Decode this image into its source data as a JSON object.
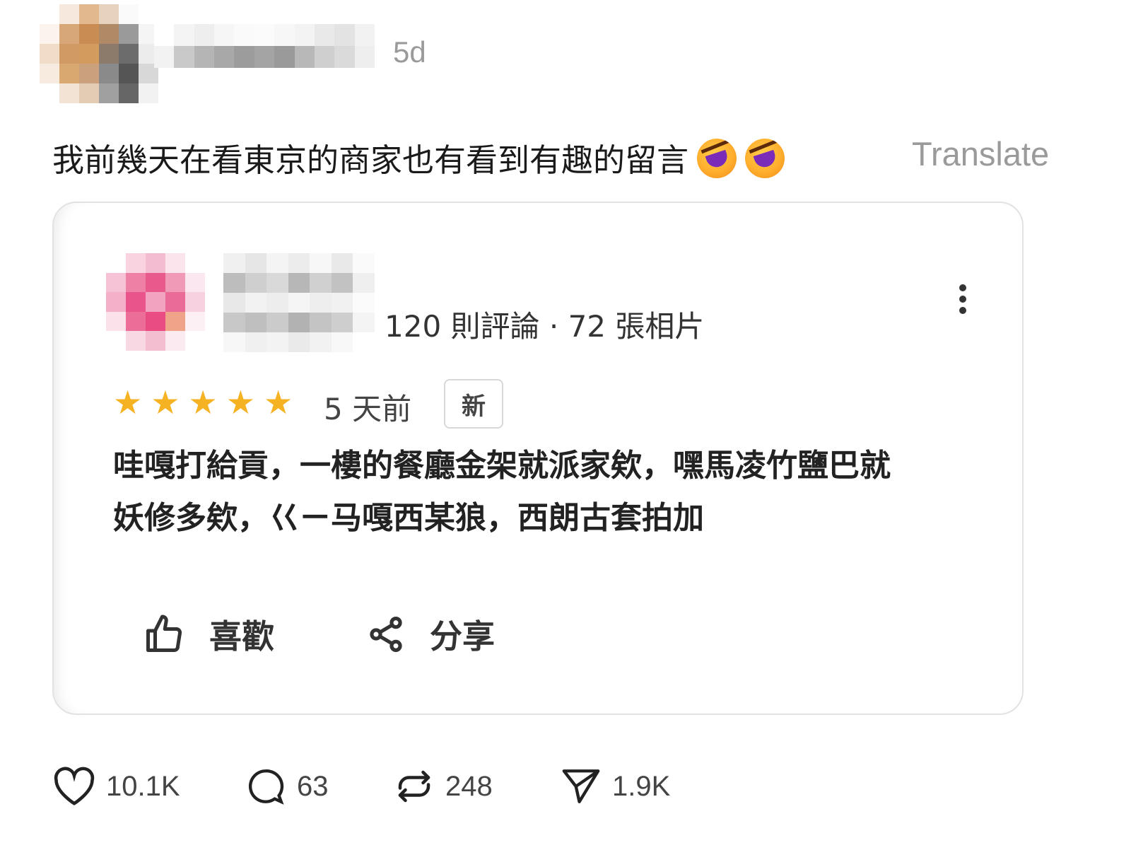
{
  "post": {
    "time": "5d",
    "text": "我前幾天在看東京的商家也有看到有趣的留言",
    "translate_label": "Translate",
    "emoji": [
      "rolling-on-floor-laughing",
      "rolling-on-floor-laughing"
    ]
  },
  "review": {
    "meta": "120 則評論 · 72 張相片",
    "rating": 5,
    "stars": [
      "★",
      "★",
      "★",
      "★",
      "★"
    ],
    "age": "5 天前",
    "badge": "新",
    "lines": [
      "哇嘎打給貢，一樓的餐廳金架就派家欸，嘿馬凌竹鹽巴就",
      "妖修多欸，巜ㄧ马嘎西某狼，西朗古套拍加"
    ],
    "like_label": "喜歡",
    "share_label": "分享"
  },
  "footer": {
    "likes": "10.1K",
    "comments": "63",
    "reposts": "248",
    "shares": "1.9K"
  },
  "colors": {
    "star": "#f5b223",
    "muted_text": "#9a9a9a",
    "card_border": "#e2e2e2"
  }
}
